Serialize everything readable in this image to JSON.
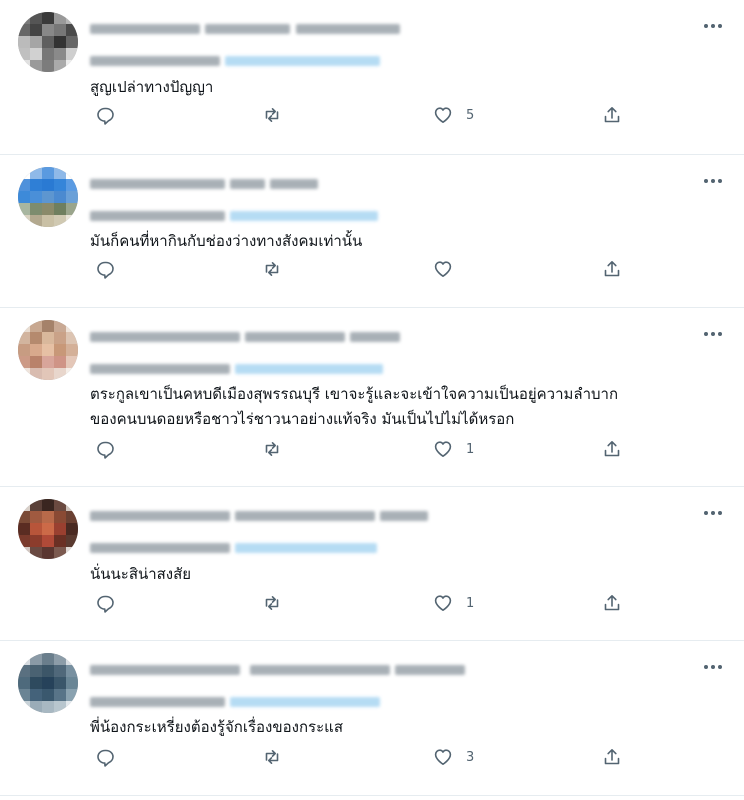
{
  "colors": {
    "icon": "#536471",
    "divider": "#e6ecf0",
    "text": "#0f1419",
    "link_blur": "#a9d6f2",
    "name_blur": "#9aa3aa"
  },
  "icons": {
    "reply": "reply-icon",
    "retweet": "retweet-icon",
    "like": "heart-icon",
    "share": "share-icon",
    "more": "more-horizontal-icon"
  },
  "tweets": [
    {
      "text": "สูญเปล่าทางปัญญา",
      "like_count": "5",
      "avatar": [
        "#7a7a7a",
        "#555",
        "#3a3a3a",
        "#999",
        "#b5b5b5",
        "#666",
        "#444",
        "#888",
        "#777",
        "#4a4a4a",
        "#bbb",
        "#a5a5a5",
        "#5f5f5f",
        "#333",
        "#666",
        "#c0c0c0",
        "#d1d1d1",
        "#777",
        "#8a8a8a",
        "#cfcfcf",
        "#e0e0e0",
        "#9a9a9a",
        "#7c7c7c",
        "#aaaaaa",
        "#ececec"
      ]
    },
    {
      "text": "มันก็คนที่หากินกับช่องว่างทางสังคมเท่านั้น",
      "like_count": "",
      "avatar": [
        "#ffffff",
        "#8fb9e8",
        "#5a9ae0",
        "#8fb9e8",
        "#ffffff",
        "#4f91db",
        "#2f7fd6",
        "#2a7ad3",
        "#3585d9",
        "#5b9be2",
        "#3d8ad9",
        "#4a8fd8",
        "#5d96d0",
        "#4b8ad0",
        "#6aa0d8",
        "#a8b6a0",
        "#7d8c6e",
        "#8a8a6a",
        "#6f7f5f",
        "#9aa58c",
        "#d8d2c0",
        "#b3a98f",
        "#c9c0a5",
        "#d0c9b2",
        "#e8e4d8"
      ]
    },
    {
      "text": "ตระกูลเขาเป็นคหบดีเมืองสุพรรณบุรี เขาจะรู้และจะเข้าใจความเป็นอยู่ความลำบาก\nของคนบนดอยหรือชาวไร่ชาวนาอย่างแท้จริง มันเป็นไปไม่ได้หรอก",
      "like_count": "1",
      "avatar": [
        "#e9dcd0",
        "#c8a890",
        "#a5826a",
        "#c9a994",
        "#eee2d8",
        "#d2b49e",
        "#b58a6e",
        "#d9b89c",
        "#caa288",
        "#dcc4b2",
        "#c79c82",
        "#d8a98c",
        "#e6c0a4",
        "#c89878",
        "#d4b098",
        "#cc9a86",
        "#b9826a",
        "#d8a59a",
        "#cf9486",
        "#e4c7b8",
        "#efe4dc",
        "#d9bcb0",
        "#e2c6b8",
        "#e8d6cc",
        "#f5eee8"
      ]
    },
    {
      "text": "นั่นนะสิน่าสงสัย",
      "like_count": "1",
      "avatar": [
        "#d8cfc8",
        "#5a4038",
        "#3a2620",
        "#6b4a40",
        "#cfc4bc",
        "#7a4a36",
        "#a05a40",
        "#b86a4a",
        "#8a4a34",
        "#6a4032",
        "#5a2c22",
        "#b8553a",
        "#cc6a48",
        "#9a4030",
        "#4a2a22",
        "#7a3a2c",
        "#8c3c2c",
        "#b04a38",
        "#6a3024",
        "#5a3a30",
        "#d2c6c0",
        "#6a4a42",
        "#5a3630",
        "#7c5a50",
        "#e0d8d4"
      ]
    },
    {
      "text": "พี่น้องกระเหรี่ยงต้องรู้จักเรื่องของกระแส",
      "like_count": "3",
      "avatar": [
        "#d6dbe0",
        "#8a9aa6",
        "#6a7e8c",
        "#8c9ca8",
        "#d8dde2",
        "#5a7080",
        "#4a6272",
        "#3c5668",
        "#50687a",
        "#7890a0",
        "#4e6a7c",
        "#2e4a5e",
        "#26425a",
        "#3a566a",
        "#6a8696",
        "#6a8494",
        "#44627a",
        "#3a586e",
        "#587488",
        "#8aa2b0",
        "#c8d2d8",
        "#9aacb8",
        "#a8b8c2",
        "#b8c6ce",
        "#e2e8ec"
      ]
    }
  ]
}
